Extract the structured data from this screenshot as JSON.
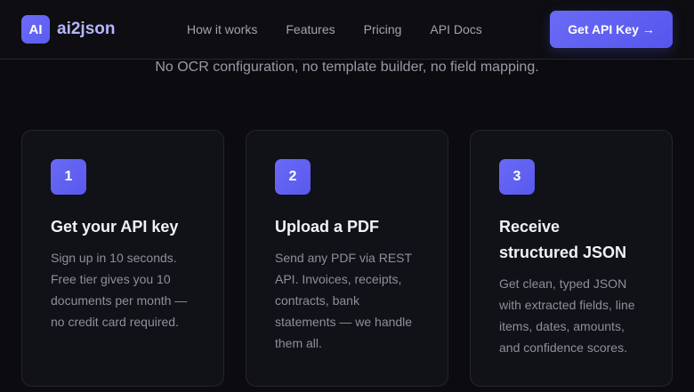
{
  "nav": {
    "logo_badge": "AI",
    "logo_text": "ai2json",
    "links": [
      "How it works",
      "Features",
      "Pricing",
      "API Docs"
    ],
    "cta_label": "Get API Key →"
  },
  "hero": {
    "subtitle": "No OCR configuration, no template builder, no field mapping."
  },
  "steps": [
    {
      "number": "1",
      "title": "Get your API key",
      "description": "Sign up in 10 seconds. Free tier gives you 10 documents per month — no credit card required."
    },
    {
      "number": "2",
      "title": "Upload a PDF",
      "description": "Send any PDF via REST API. Invoices, receipts, contracts, bank statements — we handle them all."
    },
    {
      "number": "3",
      "title": "Receive structured JSON",
      "description": "Get clean, typed JSON with extracted fields, line items, dates, amounts, and confidence scores."
    }
  ],
  "colors": {
    "background": "#0b0b10",
    "card": "#111118",
    "accent": "#6366f1",
    "logo_text": "#b6b6ff"
  }
}
